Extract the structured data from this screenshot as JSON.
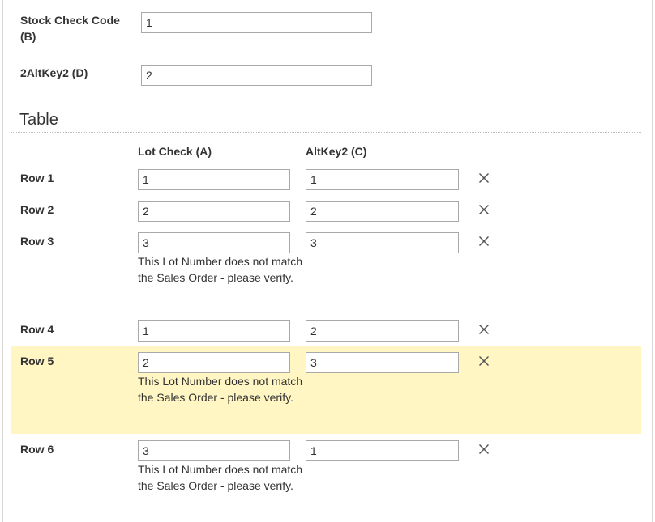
{
  "header_fields": {
    "stock_check_code": {
      "label": "Stock Check Code (B)",
      "value": "1"
    },
    "alt_key2": {
      "label": "2AltKey2 (D)",
      "value": "2"
    }
  },
  "table": {
    "title": "Table",
    "columns": [
      "Lot Check (A)",
      "AltKey2 (C)"
    ],
    "remove_icon": "close-x-icon",
    "warning_text": "This Lot Number does not match the Sales Order - please verify.",
    "highlight_color": "#fff6c4",
    "rows": [
      {
        "label": "Row 1",
        "lot_check": "1",
        "alt_key2": "1",
        "warning": ""
      },
      {
        "label": "Row 2",
        "lot_check": "2",
        "alt_key2": "2",
        "warning": ""
      },
      {
        "label": "Row 3",
        "lot_check": "3",
        "alt_key2": "3",
        "warning": "This Lot Number does not match the Sales Order - please verify."
      },
      {
        "label": "Row 4",
        "lot_check": "1",
        "alt_key2": "2",
        "warning": ""
      },
      {
        "label": "Row 5",
        "lot_check": "2",
        "alt_key2": "3",
        "warning": "This Lot Number does not match the Sales Order - please verify.",
        "highlighted": true
      },
      {
        "label": "Row 6",
        "lot_check": "3",
        "alt_key2": "1",
        "warning": "This Lot Number does not match the Sales Order - please verify."
      }
    ]
  }
}
